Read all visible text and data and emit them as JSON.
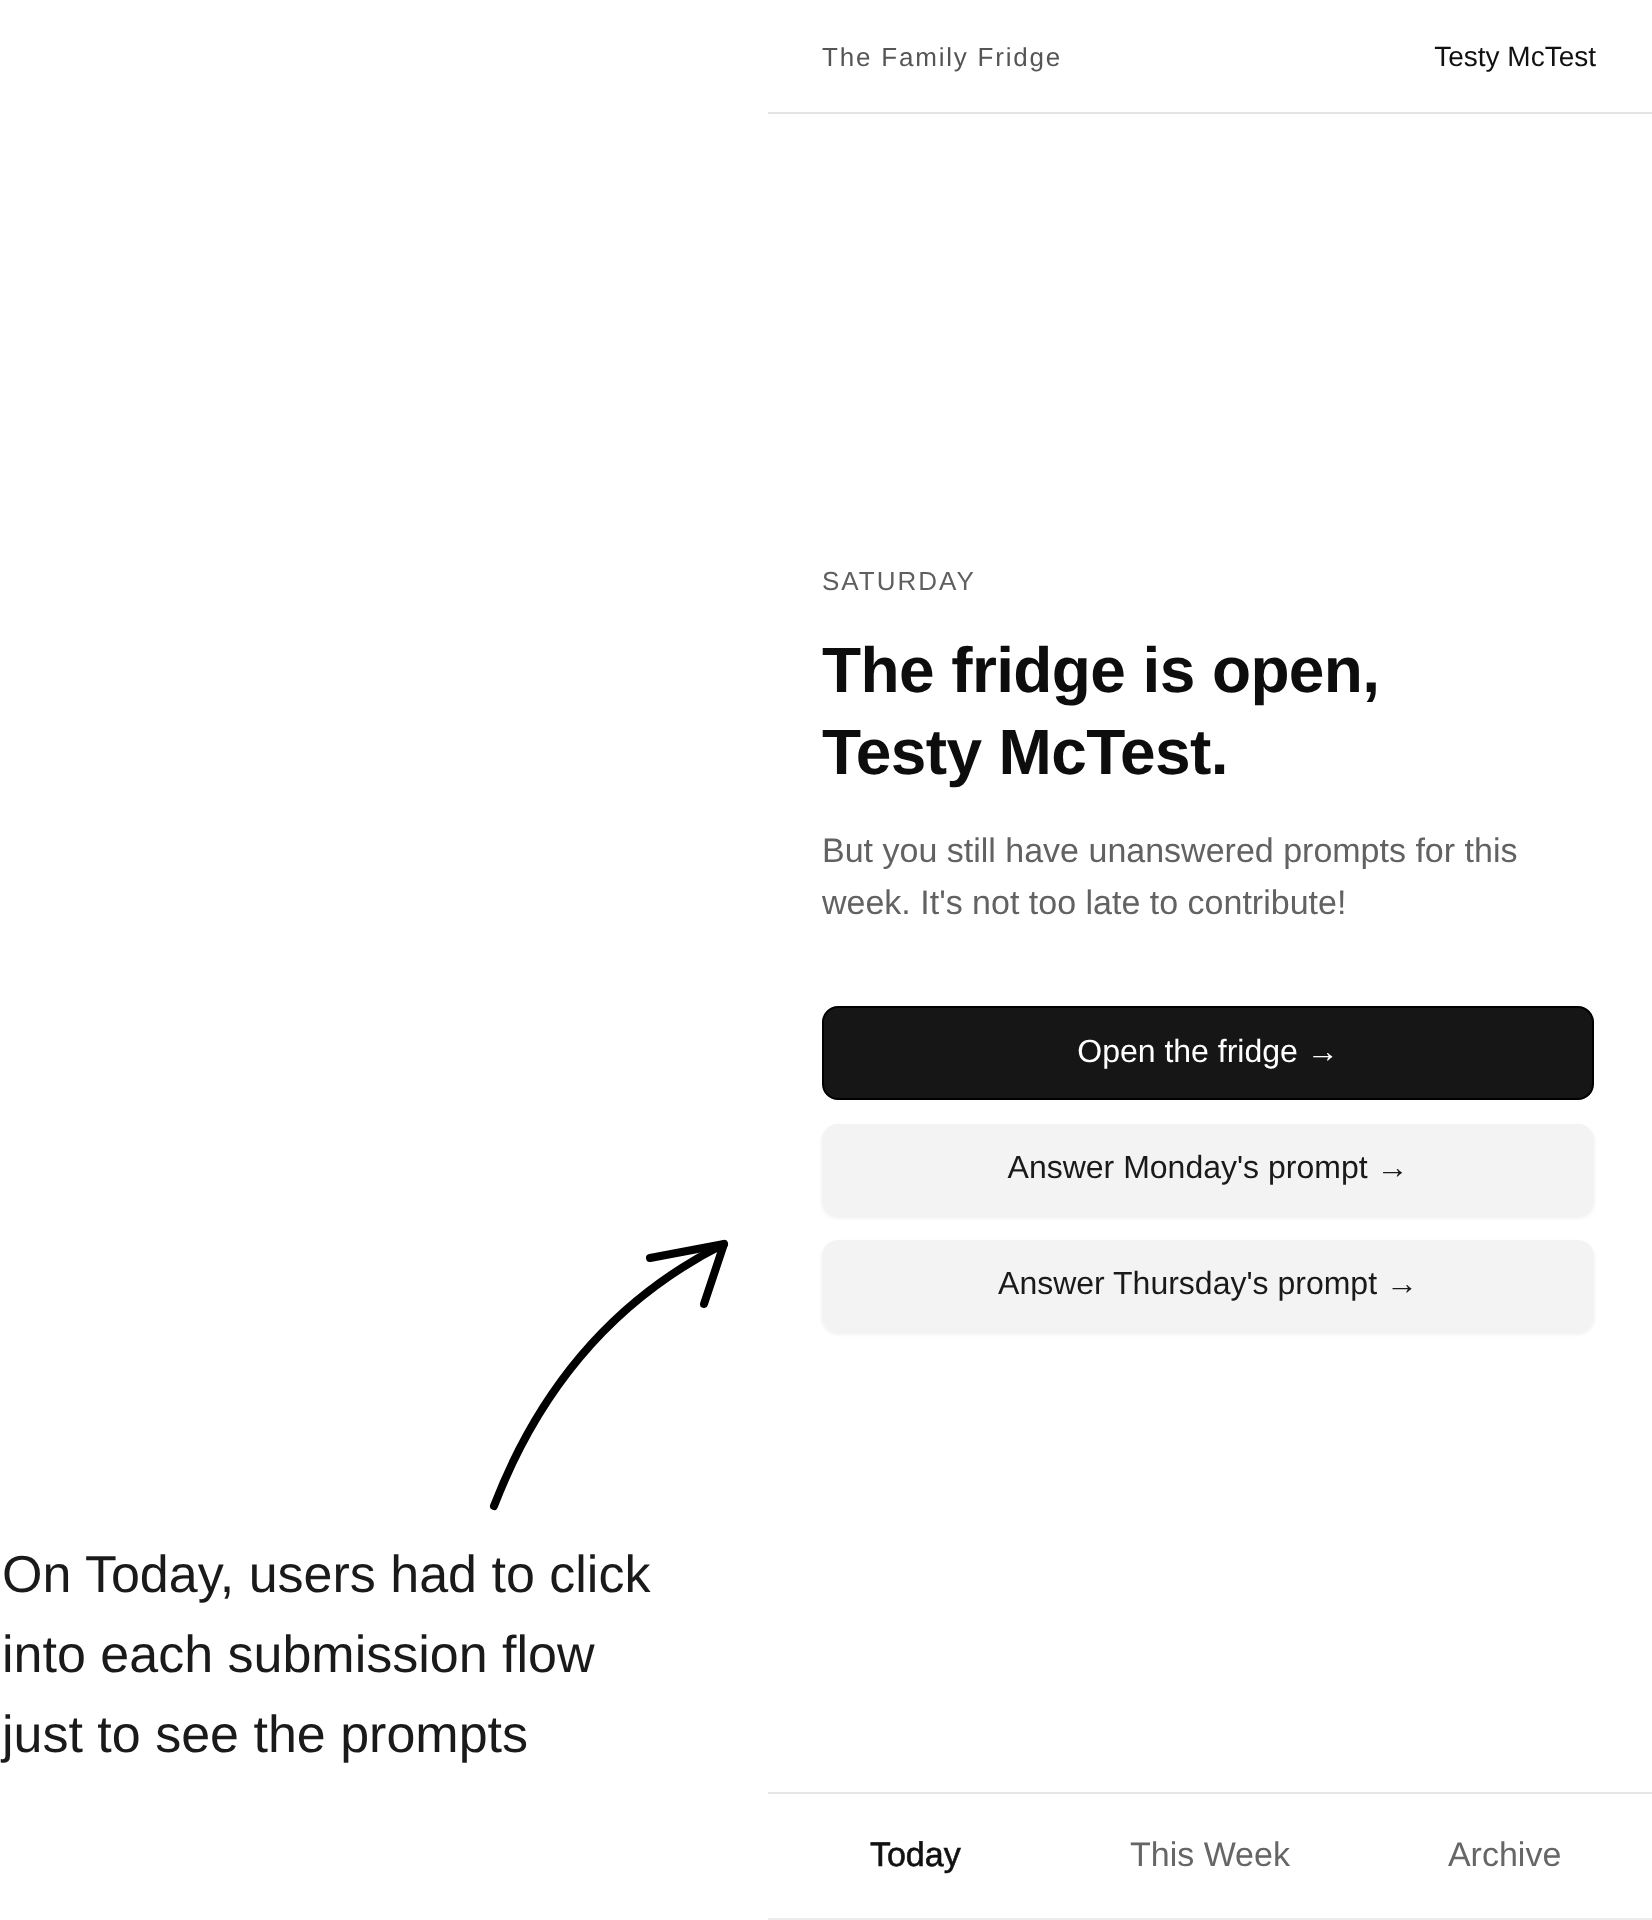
{
  "annotation": {
    "text": "On Today, users had to click into each submission flow just to see the prompts"
  },
  "header": {
    "title": "The Family Fridge",
    "user": "Testy McTest"
  },
  "hero": {
    "day": "SATURDAY",
    "heading": "The fridge is open, Testy McTest.",
    "message": "But you still have unanswered prompts for this week. It's not too late to contribute!"
  },
  "actions": [
    {
      "label": "Open the fridge →",
      "kind": "primary"
    },
    {
      "label": "Answer Monday's prompt →",
      "kind": "secondary"
    },
    {
      "label": "Answer Thursday's prompt →",
      "kind": "secondary"
    }
  ],
  "tabs": [
    {
      "label": "Today",
      "selected": true
    },
    {
      "label": "This Week",
      "selected": false
    },
    {
      "label": "Archive",
      "selected": false
    }
  ]
}
